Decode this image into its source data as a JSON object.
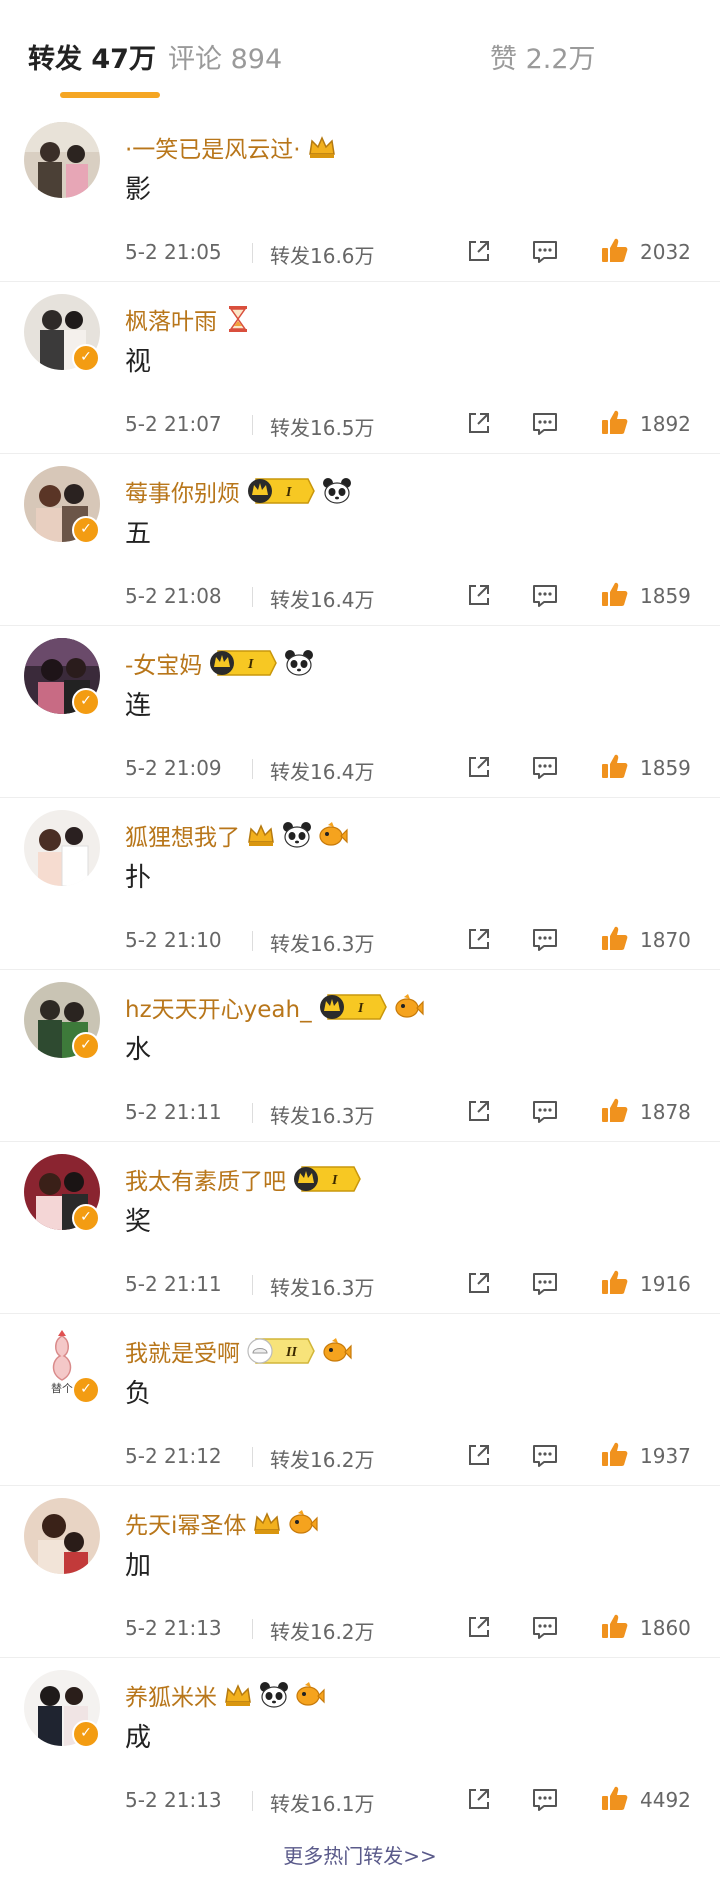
{
  "tabs": {
    "repost": "转发 47万",
    "comment": "评论 894",
    "like": "赞 2.2万"
  },
  "colors": {
    "accent": "#f5a623",
    "username": "#b8761a",
    "verified": "#f39c12",
    "like_icon": "#f0921e"
  },
  "items": [
    {
      "name": "·一笑已是风云过·",
      "content": "影",
      "time": "5-2 21:05",
      "reposts": "转发16.6万",
      "likes": "2032",
      "badges": [
        "crown-icon"
      ],
      "verified": false
    },
    {
      "name": "枫落叶雨",
      "content": "视",
      "time": "5-2 21:07",
      "reposts": "转发16.5万",
      "likes": "1892",
      "badges": [
        "hourglass-icon"
      ],
      "verified": true
    },
    {
      "name": "莓事你别烦",
      "content": "五",
      "time": "5-2 21:08",
      "reposts": "转发16.4万",
      "likes": "1859",
      "badges": [
        "level-badge-icon",
        "panda-icon"
      ],
      "verified": true
    },
    {
      "name": "-女宝妈",
      "content": "连",
      "time": "5-2 21:09",
      "reposts": "转发16.4万",
      "likes": "1859",
      "badges": [
        "level-badge-icon",
        "panda-icon"
      ],
      "verified": true
    },
    {
      "name": "狐狸想我了",
      "content": "扑",
      "time": "5-2 21:10",
      "reposts": "转发16.3万",
      "likes": "1870",
      "badges": [
        "crown-icon",
        "panda-icon",
        "fish-icon"
      ],
      "verified": false
    },
    {
      "name": "hz天天开心yeah_",
      "content": "水",
      "time": "5-2 21:11",
      "reposts": "转发16.3万",
      "likes": "1878",
      "badges": [
        "level-badge-icon",
        "fish-icon"
      ],
      "verified": true
    },
    {
      "name": "我太有素质了吧",
      "content": "奖",
      "time": "5-2 21:11",
      "reposts": "转发16.3万",
      "likes": "1916",
      "badges": [
        "level-badge-icon"
      ],
      "verified": true
    },
    {
      "name": "我就是受啊",
      "content": "负",
      "time": "5-2 21:12",
      "reposts": "转发16.2万",
      "likes": "1937",
      "badges": [
        "level-badge-icon",
        "fish-icon"
      ],
      "verified": true
    },
    {
      "name": "先天i幂圣体",
      "content": "加",
      "time": "5-2 21:13",
      "reposts": "转发16.2万",
      "likes": "1860",
      "badges": [
        "crown-icon",
        "fish-icon"
      ],
      "verified": false
    },
    {
      "name": "养狐米米",
      "content": "成",
      "time": "5-2 21:13",
      "reposts": "转发16.1万",
      "likes": "4492",
      "badges": [
        "crown-icon",
        "panda-icon",
        "fish-icon"
      ],
      "verified": true
    }
  ],
  "avatar_caption": "替个",
  "level_mark": "I",
  "level_mark_2": "II",
  "more_link": "更多热门转发>>"
}
